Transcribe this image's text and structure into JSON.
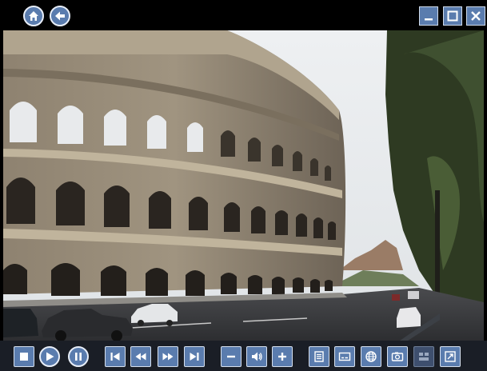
{
  "window": {
    "top_buttons": [
      "home-icon",
      "back-arrow-icon"
    ],
    "window_controls": [
      "minimize-icon",
      "maximize-icon",
      "close-icon"
    ]
  },
  "video": {
    "content": "colosseum-street-scene"
  },
  "controls": {
    "playback": [
      "stop-icon",
      "play-icon",
      "pause-icon"
    ],
    "navigation": [
      "skip-start-icon",
      "rewind-icon",
      "fast-forward-icon",
      "skip-end-icon"
    ],
    "volume": [
      "volume-down-icon",
      "speaker-icon",
      "volume-up-icon"
    ],
    "tools": [
      "playlist-icon",
      "subtitle-icon",
      "globe-icon",
      "snapshot-icon",
      "multi-view-icon",
      "fullscreen-icon"
    ]
  },
  "colors": {
    "button_fill": "#5a7cae",
    "button_border": "#e8eef8",
    "bar_background": "#1a1e26",
    "disabled_button": "#3e4f6e"
  }
}
